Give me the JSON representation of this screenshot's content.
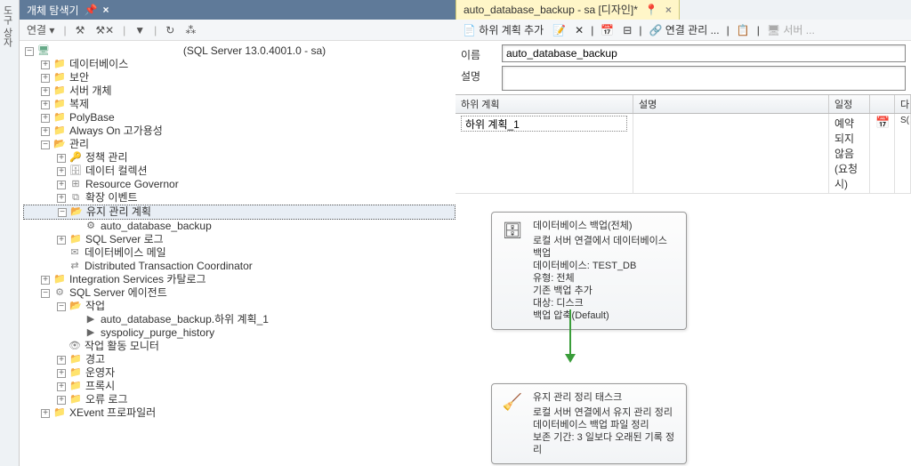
{
  "leftPanel": {
    "vtabLabel": "도구 상자",
    "tabTitle": "개체 탐색기",
    "toolbar": {
      "connect": "연결"
    }
  },
  "tree": {
    "root": "(SQL Server 13.0.4001.0 - sa)",
    "databases": "데이터베이스",
    "security": "보안",
    "serverObjects": "서버 개체",
    "replication": "복제",
    "polybase": "PolyBase",
    "alwaysOn": "Always On 고가용성",
    "management": "관리",
    "policyMgmt": "정책 관리",
    "dataCollection": "데이터 컬렉션",
    "resourceGov": "Resource Governor",
    "extEvents": "확장 이벤트",
    "maintPlans": "유지 관리 계획",
    "maintPlanItem": "auto_database_backup",
    "sqlLogs": "SQL Server 로그",
    "dbMail": "데이터베이스 메일",
    "dtc": "Distributed Transaction Coordinator",
    "isCatalogs": "Integration Services 카탈로그",
    "agent": "SQL Server 에이전트",
    "jobs": "작업",
    "job1": "auto_database_backup.하위 계획_1",
    "job2": "syspolicy_purge_history",
    "jobActivity": "작업 활동 모니터",
    "alerts": "경고",
    "operators": "운영자",
    "proxies": "프록시",
    "errorLogs": "오류 로그",
    "xevent": "XEvent 프로파일러"
  },
  "docTab": {
    "title": "auto_database_backup - sa [디자인]*"
  },
  "docToolbar": {
    "addSubplan": "하위 계획 추가",
    "connMgmt": "연결 관리 ...",
    "server": "서버 ..."
  },
  "form": {
    "nameLabel": "이름",
    "nameValue": "auto_database_backup",
    "descLabel": "설명",
    "descValue": ""
  },
  "gridHeader": {
    "subplan": "하위 계획",
    "desc": "설명",
    "schedule": "일정",
    "last": "다"
  },
  "gridRow": {
    "subplanValue": "하위 계획_1",
    "scheduleText": "예약되지 않음(요청 시)",
    "lastCell": "S(..."
  },
  "task1": {
    "title": "데이터베이스 백업(전체)",
    "line1": "로컬 서버 연결에서 데이터베이스 백업",
    "line2": "데이터베이스: TEST_DB",
    "line3": "유형: 전체",
    "line4": "기존 백업 추가",
    "line5": "대상: 디스크",
    "line6": "백업 압축(Default)"
  },
  "task2": {
    "title": "유지 관리 정리 태스크",
    "line1": "로컬 서버 연결에서 유지 관리 정리",
    "line2": "데이터베이스 백업 파일 정리",
    "line3": "보존 기간: 3 일보다 오래된 기록 정리"
  }
}
